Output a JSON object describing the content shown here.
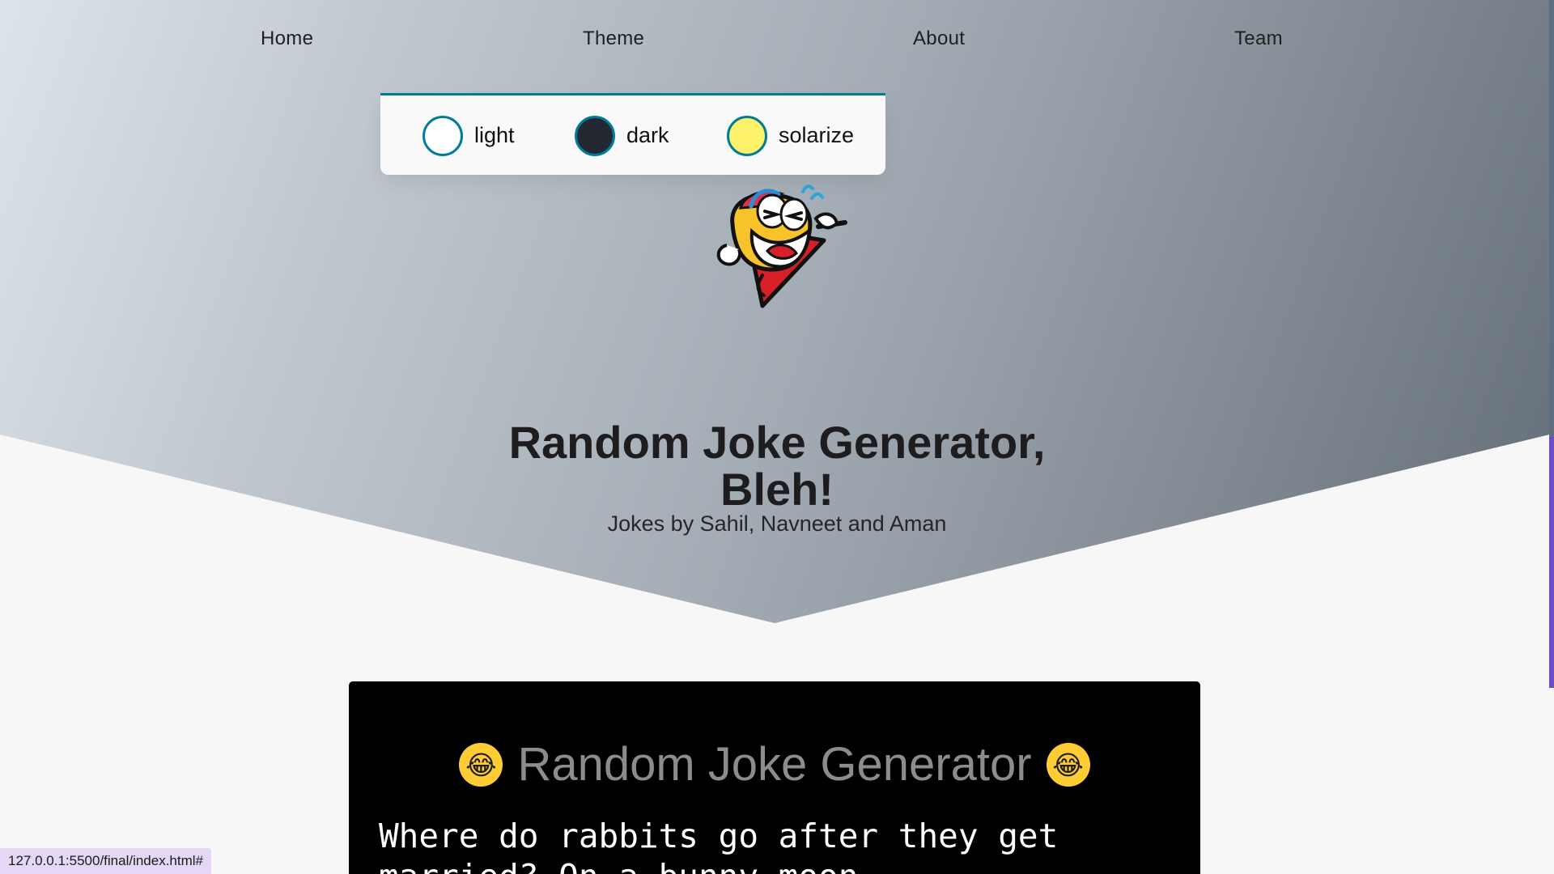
{
  "nav": {
    "items": [
      {
        "label": "Home"
      },
      {
        "label": "Theme"
      },
      {
        "label": "About"
      },
      {
        "label": "Team"
      }
    ]
  },
  "theme_menu": {
    "options": [
      {
        "label": "light",
        "color": "#ffffff"
      },
      {
        "label": "dark",
        "color": "#23272f"
      },
      {
        "label": "solarize",
        "color": "#fff36b"
      }
    ],
    "accent": "#007c99"
  },
  "hero": {
    "title_line_1": "Random Joke Generator,",
    "title_line_2": "Bleh!",
    "subtitle": "Jokes by Sahil, Navneet and Aman"
  },
  "joke_card": {
    "left_emoji": "😂",
    "title": "Random Joke Generator",
    "right_emoji": "😂",
    "joke_text": "Where do rabbits go after they get\nmarried? On a bunny moon"
  },
  "status_bar": {
    "url": "127.0.0.1:5500/final/index.html#"
  }
}
